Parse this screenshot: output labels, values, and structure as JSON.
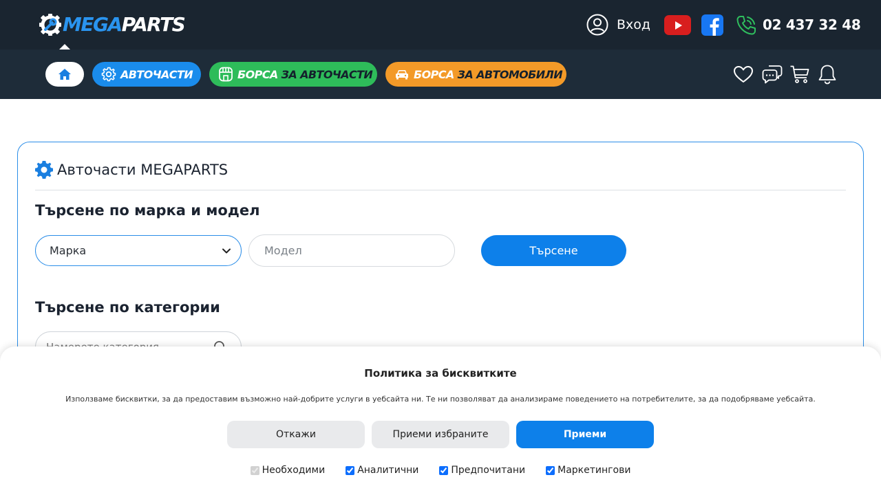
{
  "header": {
    "logo": {
      "mega": "MEGA",
      "parts": "PARTS"
    },
    "login_label": "Вход",
    "phone": "02 437 32 48",
    "icons": [
      "user-icon",
      "youtube-icon",
      "facebook-icon",
      "phone-icon"
    ]
  },
  "nav": {
    "home_icon": "home-icon",
    "pills": [
      {
        "first": "АВТОЧАСТИ",
        "second": "",
        "color": "#1a8cec",
        "icon": "gear-icon"
      },
      {
        "first": "БОРСА",
        "second": " ЗА АВТОЧАСТИ",
        "color": "#2ebc5a",
        "icon": "shop-icon"
      },
      {
        "first": "БОРСА",
        "second": " ЗА АВТОМОБИЛИ",
        "color": "#f39a28",
        "icon": "car-icon"
      }
    ],
    "right_icons": [
      "heart-icon",
      "chat-icon",
      "cart-icon",
      "bell-icon"
    ]
  },
  "main": {
    "title": "Авточасти MEGAPARTS",
    "search_by_model": {
      "heading": "Търсене по марка и модел",
      "brand_select": "Марка",
      "model_placeholder": "Модел",
      "button": "Търсене"
    },
    "search_by_category": {
      "heading": "Търсене по категории",
      "placeholder": "Намерете категория"
    }
  },
  "cookie": {
    "title": "Политика за бисквитките",
    "text": "Използваме бисквитки, за да предоставим възможно най-добрите услуги в уебсайта ни. Те ни позволяват да анализираме поведението на потребителите, за да подобряваме уебсайта.",
    "buttons": {
      "reject": "Откажи",
      "accept_selected": "Приеми избраните",
      "accept": "Приеми"
    },
    "checkboxes": [
      {
        "label": "Необходими",
        "checked": true,
        "disabled": true
      },
      {
        "label": "Аналитични",
        "checked": true,
        "disabled": false
      },
      {
        "label": "Предпочитани",
        "checked": true,
        "disabled": false
      },
      {
        "label": "Маркетингови",
        "checked": true,
        "disabled": false
      }
    ]
  },
  "colors": {
    "header_bg": "#1a2530",
    "nav_bg": "#1e2c39",
    "accent": "#0d80ea",
    "green": "#2ebc5a",
    "orange": "#f39a28"
  }
}
